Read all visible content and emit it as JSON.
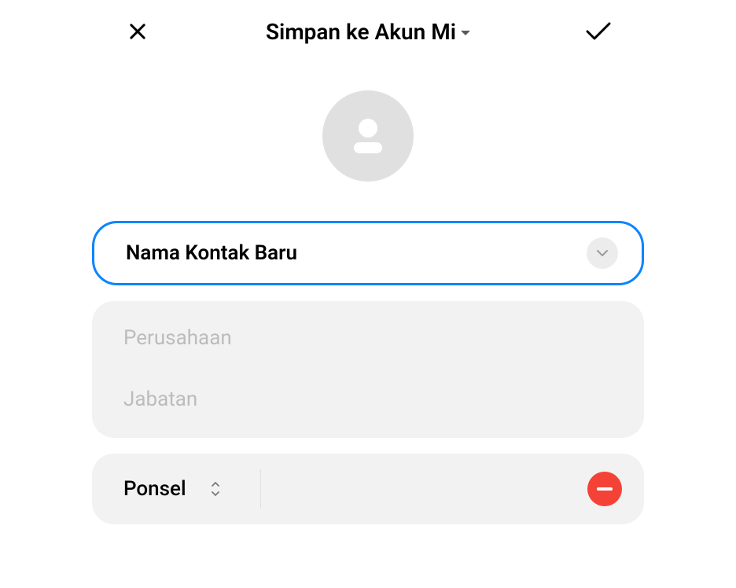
{
  "header": {
    "title": "Simpan ke Akun Mi"
  },
  "form": {
    "name_value": "Nama Kontak Baru",
    "company_placeholder": "Perusahaan",
    "job_placeholder": "Jabatan",
    "phone_type": "Ponsel"
  },
  "colors": {
    "accent": "#0a84ff",
    "danger": "#f44336",
    "muted_bg": "#f2f2f2",
    "placeholder": "#bcbcbc",
    "avatar_bg": "#e0e0e0"
  }
}
